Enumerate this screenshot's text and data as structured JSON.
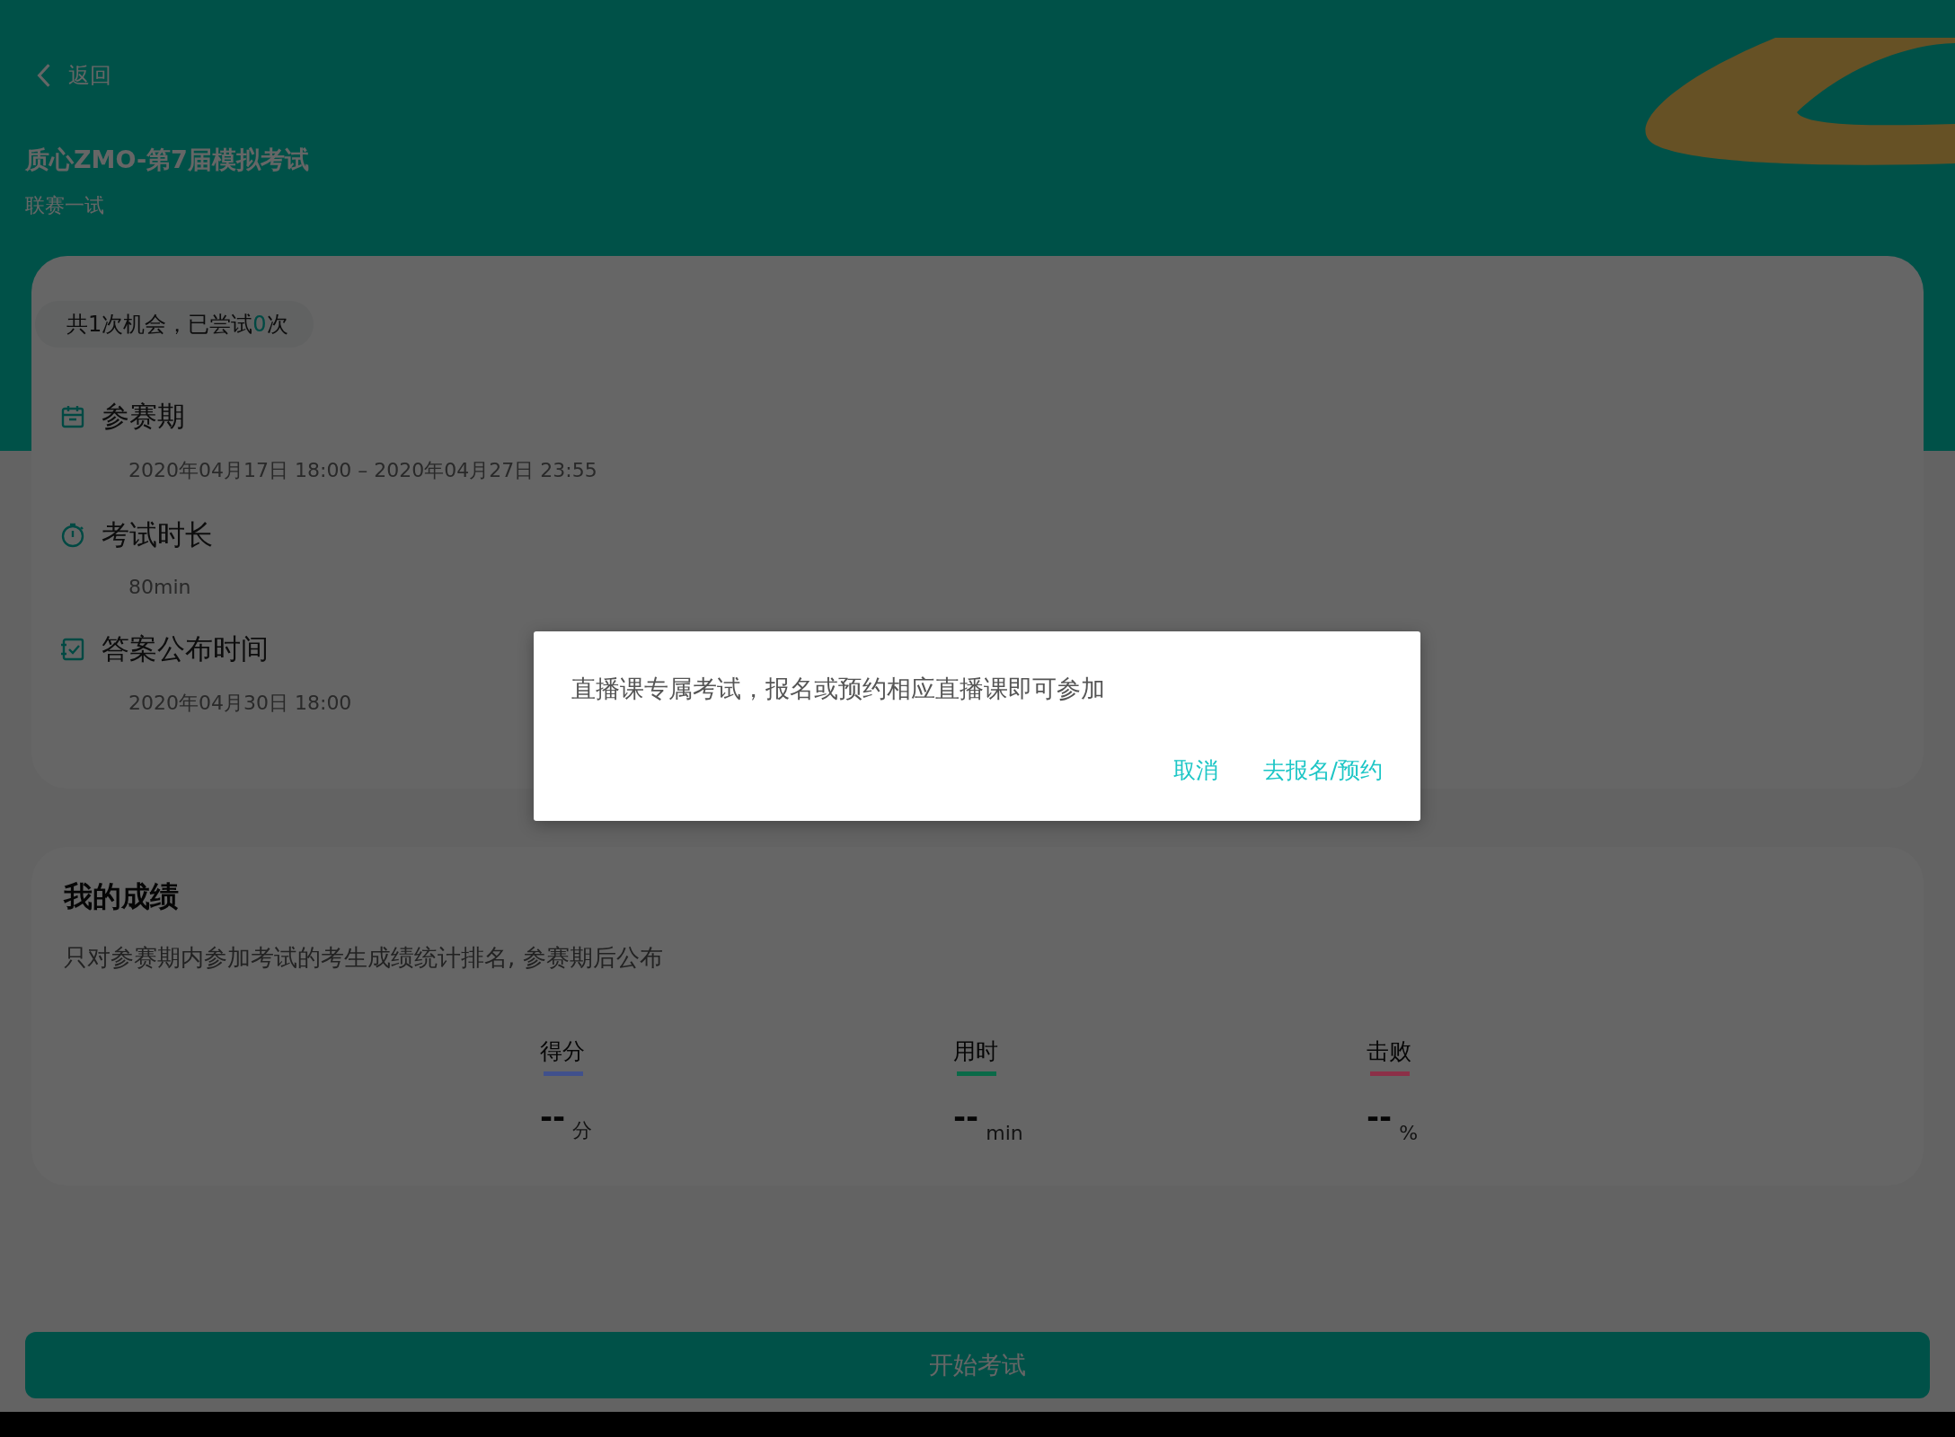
{
  "header": {
    "back": {
      "label": "返回"
    },
    "title": "质心ZMO-第7届模拟考试",
    "subtitle": "联赛一试"
  },
  "info_card": {
    "attempts": {
      "prefix": "共1次机会，已尝试",
      "count": "0",
      "suffix": "次"
    },
    "items": [
      {
        "kind": "calendar",
        "label": "参赛期",
        "value": "2020年04月17日 18:00  –  2020年04月27日 23:55"
      },
      {
        "kind": "timer",
        "label": "考试时长",
        "value": "80min"
      },
      {
        "kind": "check",
        "label": "答案公布时间",
        "value": "2020年04月30日 18:00"
      }
    ]
  },
  "scores": {
    "title": "我的成绩",
    "note": "只对参赛期内参加考试的考生成绩统计排名, 参赛期后公布",
    "stats": [
      {
        "label": "得分",
        "color": "#40508c",
        "value": "--",
        "unit": "分"
      },
      {
        "label": "用时",
        "color": "#0a6a48",
        "value": "--",
        "unit": "min"
      },
      {
        "label": "击败",
        "color": "#8c3048",
        "value": "--",
        "unit": "%"
      }
    ]
  },
  "start_button": "开始考试",
  "dialog": {
    "message": "直播课专属考试，报名或预约相应直播课即可参加",
    "buttons": [
      "取消",
      "去报名/预约"
    ]
  }
}
